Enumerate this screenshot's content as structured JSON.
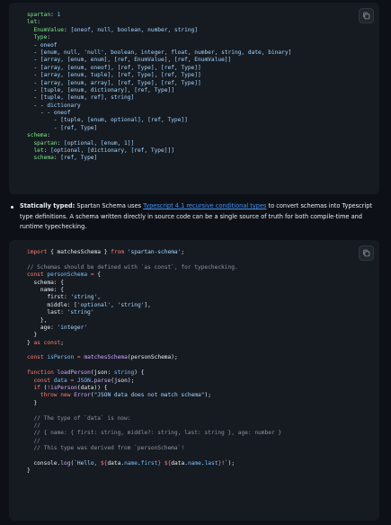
{
  "yaml_block": {
    "lines": [
      [
        {
          "t": "spartan",
          "c": "yk"
        },
        {
          "t": ": ",
          "c": "p"
        },
        {
          "t": "1",
          "c": "yn"
        }
      ],
      [
        {
          "t": "let",
          "c": "yk"
        },
        {
          "t": ":",
          "c": "p"
        }
      ],
      [
        {
          "t": "  EnumValue",
          "c": "yk"
        },
        {
          "t": ": ",
          "c": "p"
        },
        {
          "t": "[oneof, null, boolean, number, string]",
          "c": "yv"
        }
      ],
      [
        {
          "t": "  Type",
          "c": "yk"
        },
        {
          "t": ":",
          "c": "p"
        }
      ],
      [
        {
          "t": "  - ",
          "c": "p"
        },
        {
          "t": "oneof",
          "c": "yv"
        }
      ],
      [
        {
          "t": "  - ",
          "c": "p"
        },
        {
          "t": "[enum, null, 'null', boolean, integer, float, number, string, date, binary]",
          "c": "yv"
        }
      ],
      [
        {
          "t": "  - ",
          "c": "p"
        },
        {
          "t": "[array, [enum, enum], [ref, EnumValue], [ref, EnumValue]]",
          "c": "yv"
        }
      ],
      [
        {
          "t": "  - ",
          "c": "p"
        },
        {
          "t": "[array, [enum, oneof], [ref, Type], [ref, Type]]",
          "c": "yv"
        }
      ],
      [
        {
          "t": "  - ",
          "c": "p"
        },
        {
          "t": "[array, [enum, tuple], [ref, Type], [ref, Type]]",
          "c": "yv"
        }
      ],
      [
        {
          "t": "  - ",
          "c": "p"
        },
        {
          "t": "[array, [enum, array], [ref, Type], [ref, Type]]",
          "c": "yv"
        }
      ],
      [
        {
          "t": "  - ",
          "c": "p"
        },
        {
          "t": "[tuple, [enum, dictionary], [ref, Type]]",
          "c": "yv"
        }
      ],
      [
        {
          "t": "  - ",
          "c": "p"
        },
        {
          "t": "[tuple, [enum, ref], string]",
          "c": "yv"
        }
      ],
      [
        {
          "t": "  - - ",
          "c": "p"
        },
        {
          "t": "dictionary",
          "c": "yv"
        }
      ],
      [
        {
          "t": "    - - ",
          "c": "p"
        },
        {
          "t": "oneof",
          "c": "yv"
        }
      ],
      [
        {
          "t": "        - ",
          "c": "p"
        },
        {
          "t": "[tuple, [enum, optional], [ref, Type]]",
          "c": "yv"
        }
      ],
      [
        {
          "t": "        - ",
          "c": "p"
        },
        {
          "t": "[ref, Type]",
          "c": "yv"
        }
      ],
      [
        {
          "t": "schema",
          "c": "yk"
        },
        {
          "t": ":",
          "c": "p"
        }
      ],
      [
        {
          "t": "  spartan",
          "c": "yk"
        },
        {
          "t": ": ",
          "c": "p"
        },
        {
          "t": "[optional, [enum, 1]]",
          "c": "yv"
        }
      ],
      [
        {
          "t": "  let",
          "c": "yk"
        },
        {
          "t": ": ",
          "c": "p"
        },
        {
          "t": "[optional, [dictionary, [ref, Type]]]",
          "c": "yv"
        }
      ],
      [
        {
          "t": "  schema",
          "c": "yk"
        },
        {
          "t": ": ",
          "c": "p"
        },
        {
          "t": "[ref, Type]",
          "c": "yv"
        }
      ]
    ]
  },
  "bullet": {
    "title": "Statically typed:",
    "text_before": " Spartan Schema uses ",
    "link_text": "Typescript 4.1 recursive conditional types",
    "text_after": " to convert schemas into Typescript type definitions. A schema written directly in source code can be a single source of truth for both compile-time and runtime typechecking."
  },
  "ts_block": {
    "lines": [
      [
        {
          "t": "import",
          "c": "k"
        },
        {
          "t": " { matchesSchema } ",
          "c": "p"
        },
        {
          "t": "from",
          "c": "k"
        },
        {
          "t": " ",
          "c": "p"
        },
        {
          "t": "'spartan-schema'",
          "c": "s"
        },
        {
          "t": ";",
          "c": "p"
        }
      ],
      [],
      [
        {
          "t": "// Schemas should be defined with `as const`, for typechecking.",
          "c": "c"
        }
      ],
      [
        {
          "t": "const",
          "c": "k"
        },
        {
          "t": " ",
          "c": "p"
        },
        {
          "t": "personSchema",
          "c": "v"
        },
        {
          "t": " ",
          "c": "p"
        },
        {
          "t": "=",
          "c": "k"
        },
        {
          "t": " {",
          "c": "p"
        }
      ],
      [
        {
          "t": "  schema: {",
          "c": "p"
        }
      ],
      [
        {
          "t": "    name: {",
          "c": "p"
        }
      ],
      [
        {
          "t": "      first: ",
          "c": "p"
        },
        {
          "t": "'string'",
          "c": "s"
        },
        {
          "t": ",",
          "c": "p"
        }
      ],
      [
        {
          "t": "      middle: [",
          "c": "p"
        },
        {
          "t": "'optional'",
          "c": "s"
        },
        {
          "t": ", ",
          "c": "p"
        },
        {
          "t": "'string'",
          "c": "s"
        },
        {
          "t": "],",
          "c": "p"
        }
      ],
      [
        {
          "t": "      last: ",
          "c": "p"
        },
        {
          "t": "'string'",
          "c": "s"
        }
      ],
      [
        {
          "t": "    },",
          "c": "p"
        }
      ],
      [
        {
          "t": "    age: ",
          "c": "p"
        },
        {
          "t": "'integer'",
          "c": "s"
        }
      ],
      [
        {
          "t": "  }",
          "c": "p"
        }
      ],
      [
        {
          "t": "} ",
          "c": "p"
        },
        {
          "t": "as",
          "c": "k"
        },
        {
          "t": " ",
          "c": "p"
        },
        {
          "t": "const",
          "c": "k"
        },
        {
          "t": ";",
          "c": "p"
        }
      ],
      [],
      [
        {
          "t": "const",
          "c": "k"
        },
        {
          "t": " ",
          "c": "p"
        },
        {
          "t": "isPerson",
          "c": "v"
        },
        {
          "t": " ",
          "c": "p"
        },
        {
          "t": "=",
          "c": "k"
        },
        {
          "t": " ",
          "c": "p"
        },
        {
          "t": "matchesSchema",
          "c": "f"
        },
        {
          "t": "(personSchema);",
          "c": "p"
        }
      ],
      [],
      [
        {
          "t": "function",
          "c": "k"
        },
        {
          "t": " ",
          "c": "p"
        },
        {
          "t": "loadPerson",
          "c": "f"
        },
        {
          "t": "(json: ",
          "c": "p"
        },
        {
          "t": "string",
          "c": "v"
        },
        {
          "t": ") {",
          "c": "p"
        }
      ],
      [
        {
          "t": "  ",
          "c": "p"
        },
        {
          "t": "const",
          "c": "k"
        },
        {
          "t": " ",
          "c": "p"
        },
        {
          "t": "data",
          "c": "v"
        },
        {
          "t": " ",
          "c": "p"
        },
        {
          "t": "=",
          "c": "k"
        },
        {
          "t": " ",
          "c": "p"
        },
        {
          "t": "JSON",
          "c": "v"
        },
        {
          "t": ".",
          "c": "p"
        },
        {
          "t": "parse",
          "c": "f"
        },
        {
          "t": "(json);",
          "c": "p"
        }
      ],
      [
        {
          "t": "  ",
          "c": "p"
        },
        {
          "t": "if",
          "c": "k"
        },
        {
          "t": " (",
          "c": "p"
        },
        {
          "t": "!",
          "c": "k"
        },
        {
          "t": "isPerson",
          "c": "f"
        },
        {
          "t": "(data)) {",
          "c": "p"
        }
      ],
      [
        {
          "t": "    ",
          "c": "p"
        },
        {
          "t": "throw",
          "c": "k"
        },
        {
          "t": " ",
          "c": "p"
        },
        {
          "t": "new",
          "c": "k"
        },
        {
          "t": " ",
          "c": "p"
        },
        {
          "t": "Error",
          "c": "f"
        },
        {
          "t": "(",
          "c": "p"
        },
        {
          "t": "\"JSON data does not match schema\"",
          "c": "s"
        },
        {
          "t": ");",
          "c": "p"
        }
      ],
      [
        {
          "t": "  }",
          "c": "p"
        }
      ],
      [],
      [
        {
          "t": "  // The type of `data` is now:",
          "c": "c"
        }
      ],
      [
        {
          "t": "  //",
          "c": "c"
        }
      ],
      [
        {
          "t": "  // { name: { first: string, middle?: string, last: string }, age: number }",
          "c": "c"
        }
      ],
      [
        {
          "t": "  //",
          "c": "c"
        }
      ],
      [
        {
          "t": "  // This type was derived from `personSchema`!",
          "c": "c"
        }
      ],
      [],
      [
        {
          "t": "  console",
          "c": "p"
        },
        {
          "t": ".",
          "c": "p"
        },
        {
          "t": "log",
          "c": "f"
        },
        {
          "t": "(",
          "c": "p"
        },
        {
          "t": "`Hello, ",
          "c": "s"
        },
        {
          "t": "${",
          "c": "k"
        },
        {
          "t": "data",
          "c": "p"
        },
        {
          "t": ".",
          "c": "p"
        },
        {
          "t": "name",
          "c": "v"
        },
        {
          "t": ".",
          "c": "p"
        },
        {
          "t": "first",
          "c": "v"
        },
        {
          "t": "}",
          "c": "k"
        },
        {
          "t": " ",
          "c": "s"
        },
        {
          "t": "${",
          "c": "k"
        },
        {
          "t": "data",
          "c": "p"
        },
        {
          "t": ".",
          "c": "p"
        },
        {
          "t": "name",
          "c": "v"
        },
        {
          "t": ".",
          "c": "p"
        },
        {
          "t": "last",
          "c": "v"
        },
        {
          "t": "}",
          "c": "k"
        },
        {
          "t": "!`",
          "c": "s"
        },
        {
          "t": ");",
          "c": "p"
        }
      ],
      [
        {
          "t": "}",
          "c": "p"
        }
      ]
    ]
  },
  "icons": {
    "copy": "copy-icon"
  },
  "colors": {
    "background": "#0d1117",
    "code_bg": "#161b22",
    "link": "#4493f8"
  }
}
